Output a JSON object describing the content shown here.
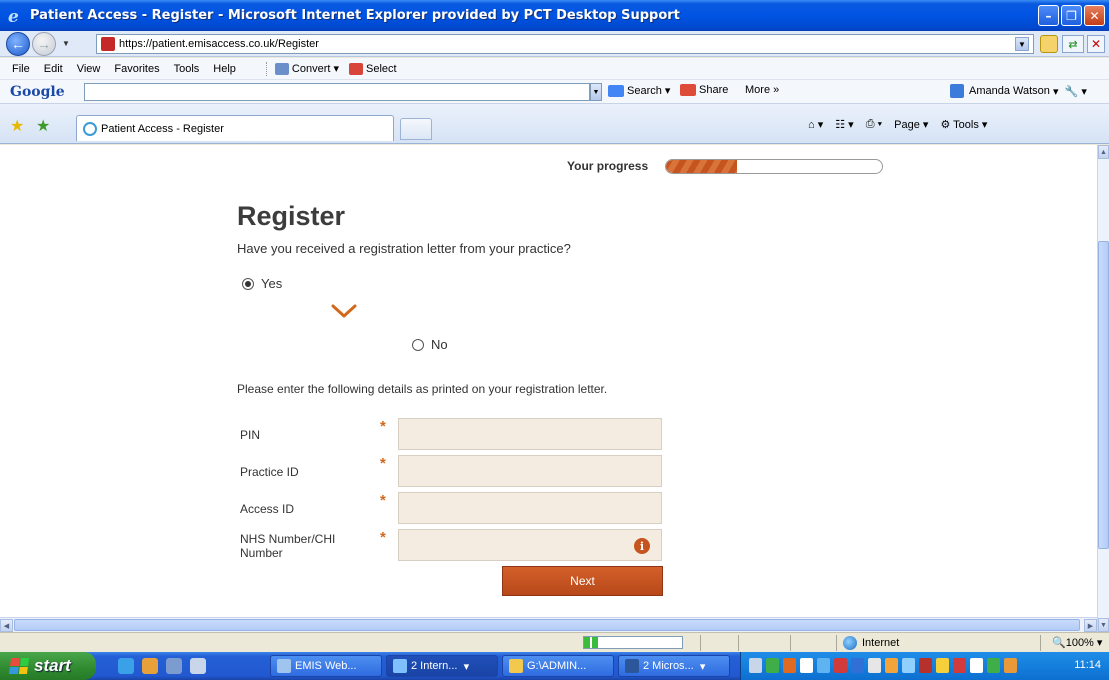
{
  "window": {
    "title": "Patient Access  - Register - Microsoft Internet Explorer provided by PCT Desktop Support"
  },
  "address": {
    "url": "https://patient.emisaccess.co.uk/Register"
  },
  "menu": {
    "items": [
      "File",
      "Edit",
      "View",
      "Favorites",
      "Tools",
      "Help"
    ],
    "convert": "Convert",
    "select": "Select"
  },
  "google_bar": {
    "logo": "Google",
    "search": "Search",
    "share": "Share",
    "more": "More »",
    "user": "Amanda Watson"
  },
  "tabs": {
    "active_tab": "Patient Access  - Register",
    "page": "Page",
    "tools": "Tools"
  },
  "page": {
    "progress_label": "Your progress",
    "progress_fraction": 0.33,
    "title": "Register",
    "question": "Have you received a registration letter from your practice?",
    "option_yes": "Yes",
    "option_no": "No",
    "selected": "Yes",
    "instructions": "Please enter the following details as printed on your registration letter.",
    "fields": [
      {
        "label": "PIN"
      },
      {
        "label": "Practice ID"
      },
      {
        "label": "Access ID"
      },
      {
        "label": "NHS Number/CHI Number"
      }
    ],
    "required_marker": "*",
    "info_marker": "i",
    "next_button": "Next"
  },
  "status": {
    "zone": "Internet",
    "zoom": "100%"
  },
  "taskbar": {
    "start": "start",
    "tasks": [
      "EMIS Web...",
      "2 Intern...",
      "G:\\ADMIN...",
      "2 Micros..."
    ],
    "clock": "11:14"
  },
  "colors": {
    "accent": "#c5541f",
    "field_bg": "#f4ece0",
    "title_text": "#3c3c3c"
  }
}
